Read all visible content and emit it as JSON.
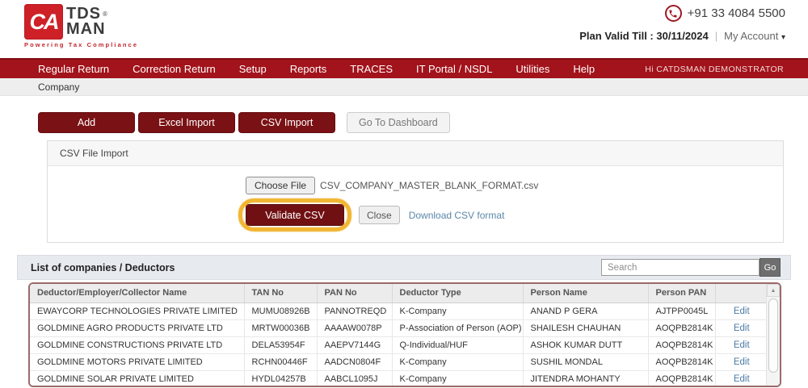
{
  "header": {
    "logo": {
      "ca": "CA",
      "tds": "TDS",
      "man": "MAN",
      "registered": "®",
      "tagline": "Powering Tax Compliance"
    },
    "phone": "+91 33 4084 5500",
    "plan_label": "Plan Valid Till :",
    "plan_date": "30/11/2024",
    "divider": "|",
    "my_account": "My Account",
    "caret_icon": "▾"
  },
  "nav": {
    "items": [
      {
        "label": "Regular Return"
      },
      {
        "label": "Correction Return"
      },
      {
        "label": "Setup"
      },
      {
        "label": "Reports"
      },
      {
        "label": "TRACES"
      },
      {
        "label": "IT Portal / NSDL"
      },
      {
        "label": "Utilities"
      },
      {
        "label": "Help"
      }
    ],
    "greeting": "Hi CATDSMAN DEMONSTRATOR"
  },
  "breadcrumb": "Company",
  "toolbar": {
    "add": "Add",
    "excel_import": "Excel Import",
    "csv_import": "CSV Import",
    "go_to_dashboard": "Go To Dashboard"
  },
  "csv_panel": {
    "title": "CSV File Import",
    "choose_file": "Choose File",
    "file_name": "CSV_COMPANY_MASTER_BLANK_FORMAT.csv",
    "validate": "Validate CSV",
    "close": "Close",
    "download_link": "Download CSV format"
  },
  "list": {
    "title": "List of companies / Deductors",
    "search_placeholder": "Search",
    "go": "Go",
    "scroll_up_icon": "▲",
    "edit_label": "Edit",
    "columns": [
      "Deductor/Employer/Collector Name",
      "TAN No",
      "PAN No",
      "Deductor Type",
      "Person Name",
      "Person PAN"
    ],
    "rows": [
      {
        "name": "EWAYCORP TECHNOLOGIES PRIVATE LIMITED",
        "tan": "MUMU08926B",
        "pan": "PANNOTREQD",
        "type": "K-Company",
        "person": "ANAND P GERA",
        "person_pan": "AJTPP0045L"
      },
      {
        "name": "GOLDMINE AGRO PRODUCTS PRIVATE LTD",
        "tan": "MRTW00036B",
        "pan": "AAAAW0078P",
        "type": "P-Association of Person (AOP)",
        "person": "SHAILESH CHAUHAN",
        "person_pan": "AOQPB2814K"
      },
      {
        "name": "GOLDMINE CONSTRUCTIONS PRIVATE LTD",
        "tan": "DELA53954F",
        "pan": "AAEPV7144G",
        "type": "Q-Individual/HUF",
        "person": "ASHOK KUMAR DUTT",
        "person_pan": "AOQPB2814K"
      },
      {
        "name": "GOLDMINE MOTORS PRIVATE LIMITED",
        "tan": "RCHN00446F",
        "pan": "AADCN0804F",
        "type": "K-Company",
        "person": "SUSHIL MONDAL",
        "person_pan": "AOQPB2814K"
      },
      {
        "name": "GOLDMINE SOLAR PRIVATE LIMITED",
        "tan": "HYDL04257B",
        "pan": "AABCL1095J",
        "type": "K-Company",
        "person": "JITENDRA MOHANTY",
        "person_pan": "AOQPB2814K"
      }
    ]
  },
  "colors": {
    "brand_red": "#ce2127",
    "nav_red": "#a2131b",
    "button_maroon": "#7a1114",
    "highlight_ring": "#f2b634",
    "link_blue": "#4a7ba6"
  }
}
